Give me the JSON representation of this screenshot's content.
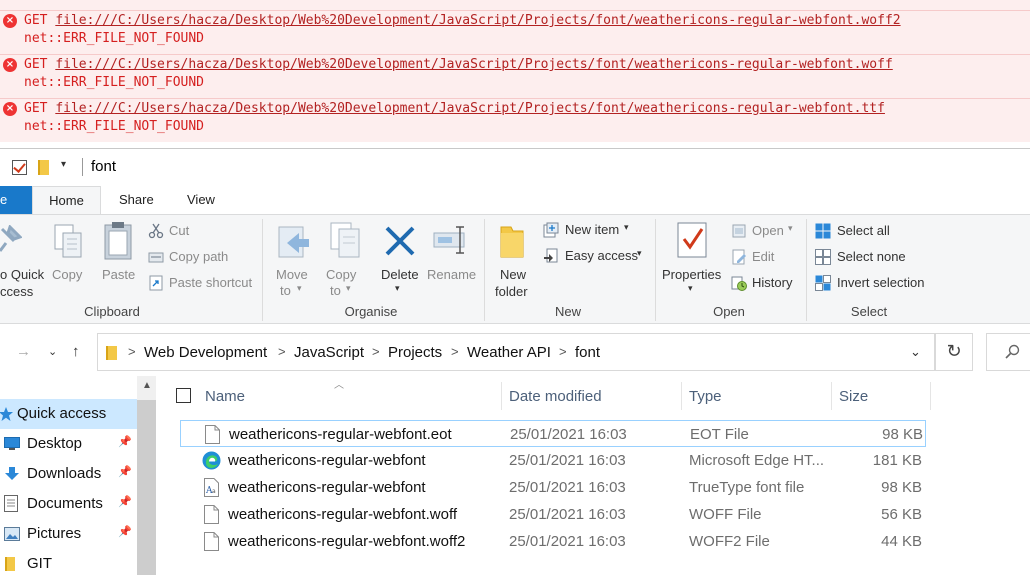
{
  "console": {
    "errors": [
      {
        "method": "GET",
        "url": "file:///C:/Users/hacza/Desktop/Web%20Development/JavaScript/Projects/font/weathericons-regular-webfont.woff2",
        "message": "net::ERR_FILE_NOT_FOUND"
      },
      {
        "method": "GET",
        "url": "file:///C:/Users/hacza/Desktop/Web%20Development/JavaScript/Projects/font/weathericons-regular-webfont.woff",
        "message": "net::ERR_FILE_NOT_FOUND"
      },
      {
        "method": "GET",
        "url": "file:///C:/Users/hacza/Desktop/Web%20Development/JavaScript/Projects/font/weathericons-regular-webfont.ttf",
        "message": "net::ERR_FILE_NOT_FOUND"
      }
    ],
    "error_icon": "error-x-icon",
    "error_color": "#d51f1f"
  },
  "window": {
    "title": "font",
    "dropdown_glyph": "▾"
  },
  "ribbon_tabs": {
    "file": "e",
    "home": "Home",
    "share": "Share",
    "view": "View",
    "accent": "#1979ca"
  },
  "ribbon": {
    "clipboard": {
      "pin_label_1": "o Quick",
      "pin_label_2": "ccess",
      "copy": "Copy",
      "paste": "Paste",
      "cut": "Cut",
      "copy_path": "Copy path",
      "paste_shortcut": "Paste shortcut",
      "group": "Clipboard"
    },
    "organise": {
      "move_to_1": "Move",
      "move_to_2": "to",
      "copy_to_1": "Copy",
      "copy_to_2": "to",
      "delete": "Delete",
      "rename": "Rename",
      "group": "Organise"
    },
    "new": {
      "new_folder_1": "New",
      "new_folder_2": "folder",
      "new_item": "New item",
      "easy_access": "Easy access",
      "group": "New"
    },
    "open": {
      "properties": "Properties",
      "open": "Open",
      "edit": "Edit",
      "history": "History",
      "group": "Open"
    },
    "select": {
      "select_all": "Select all",
      "select_none": "Select none",
      "invert_selection": "Invert selection",
      "group": "Select"
    }
  },
  "address": {
    "crumbs": [
      "Web Development",
      "JavaScript",
      "Projects",
      "Weather API",
      "font"
    ],
    "separator": ">",
    "refresh_glyph": "↻"
  },
  "nav_pane": {
    "items": [
      {
        "label": "Quick access",
        "icon": "star-icon",
        "selected": true,
        "pinned": false
      },
      {
        "label": "Desktop",
        "icon": "desktop-icon",
        "selected": false,
        "pinned": true
      },
      {
        "label": "Downloads",
        "icon": "download-icon",
        "selected": false,
        "pinned": true
      },
      {
        "label": "Documents",
        "icon": "documents-icon",
        "selected": false,
        "pinned": true
      },
      {
        "label": "Pictures",
        "icon": "pictures-icon",
        "selected": false,
        "pinned": true
      },
      {
        "label": "GIT",
        "icon": "folder-icon",
        "selected": false,
        "pinned": false
      }
    ],
    "pin_glyph": "📌"
  },
  "file_list": {
    "columns": {
      "name": "Name",
      "date": "Date modified",
      "type": "Type",
      "size": "Size"
    },
    "rows": [
      {
        "name": "weathericons-regular-webfont.eot",
        "date": "25/01/2021 16:03",
        "type": "EOT File",
        "size": "98 KB",
        "icon": "file-icon"
      },
      {
        "name": "weathericons-regular-webfont",
        "date": "25/01/2021 16:03",
        "type": "Microsoft Edge HT...",
        "size": "181 KB",
        "icon": "edge-icon"
      },
      {
        "name": "weathericons-regular-webfont",
        "date": "25/01/2021 16:03",
        "type": "TrueType font file",
        "size": "98 KB",
        "icon": "font-file-icon"
      },
      {
        "name": "weathericons-regular-webfont.woff",
        "date": "25/01/2021 16:03",
        "type": "WOFF File",
        "size": "56 KB",
        "icon": "file-icon"
      },
      {
        "name": "weathericons-regular-webfont.woff2",
        "date": "25/01/2021 16:03",
        "type": "WOFF2 File",
        "size": "44 KB",
        "icon": "file-icon"
      }
    ]
  }
}
